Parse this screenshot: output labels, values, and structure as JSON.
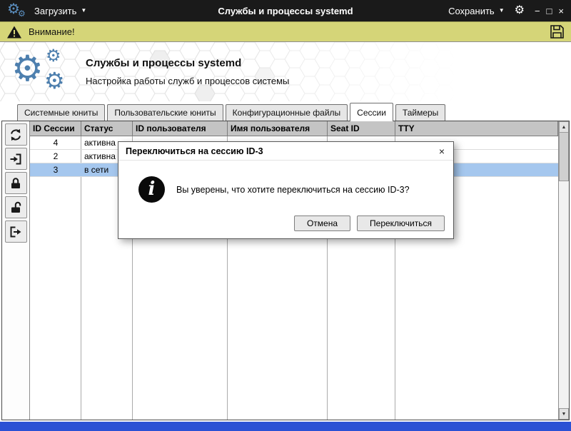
{
  "titlebar": {
    "title": "Службы и процессы systemd",
    "load_label": "Загрузить",
    "save_label": "Сохранить"
  },
  "warning_bar": {
    "label": "Внимание!"
  },
  "header": {
    "title": "Службы и процессы systemd",
    "subtitle": "Настройка работы служб и процессов системы"
  },
  "tabs": [
    {
      "label": "Системные юниты",
      "active": false
    },
    {
      "label": "Пользовательские юниты",
      "active": false
    },
    {
      "label": "Конфигурационные файлы",
      "active": false
    },
    {
      "label": "Сессии",
      "active": true
    },
    {
      "label": "Таймеры",
      "active": false
    }
  ],
  "toolbar": {
    "buttons": [
      {
        "name": "refresh",
        "icon": "refresh-icon"
      },
      {
        "name": "switch-to-session",
        "icon": "enter-session-icon"
      },
      {
        "name": "lock-session",
        "icon": "lock-icon"
      },
      {
        "name": "unlock-session",
        "icon": "unlock-icon"
      },
      {
        "name": "close-session",
        "icon": "exit-session-icon"
      }
    ]
  },
  "sessions_table": {
    "headers": [
      "ID Сессии",
      "Статус",
      "ID пользователя",
      "Имя пользователя",
      "Seat ID",
      "TTY"
    ],
    "rows": [
      {
        "session_id": "4",
        "status": "активна",
        "selected": false
      },
      {
        "session_id": "2",
        "status": "активна",
        "selected": false
      },
      {
        "session_id": "3",
        "status": "в сети",
        "selected": true
      }
    ]
  },
  "dialog": {
    "title": "Переключиться на сессию ID-3",
    "message": "Вы уверены, что хотите переключиться на сессию ID-3?",
    "cancel_label": "Отмена",
    "confirm_label": "Переключиться"
  },
  "icons": {
    "gear": "⚙",
    "dropdown_caret": "▼",
    "minimize": "−",
    "maximize": "□",
    "close": "×",
    "info": "i",
    "scroll_up": "▲",
    "scroll_down": "▼"
  },
  "colors": {
    "titlebar_bg": "#1a1a1a",
    "warning_bg": "#d5d578",
    "accent_blue": "#4d7fae",
    "selected_row_bg": "#a5c7ee",
    "footer_bg": "#2b51d4"
  }
}
